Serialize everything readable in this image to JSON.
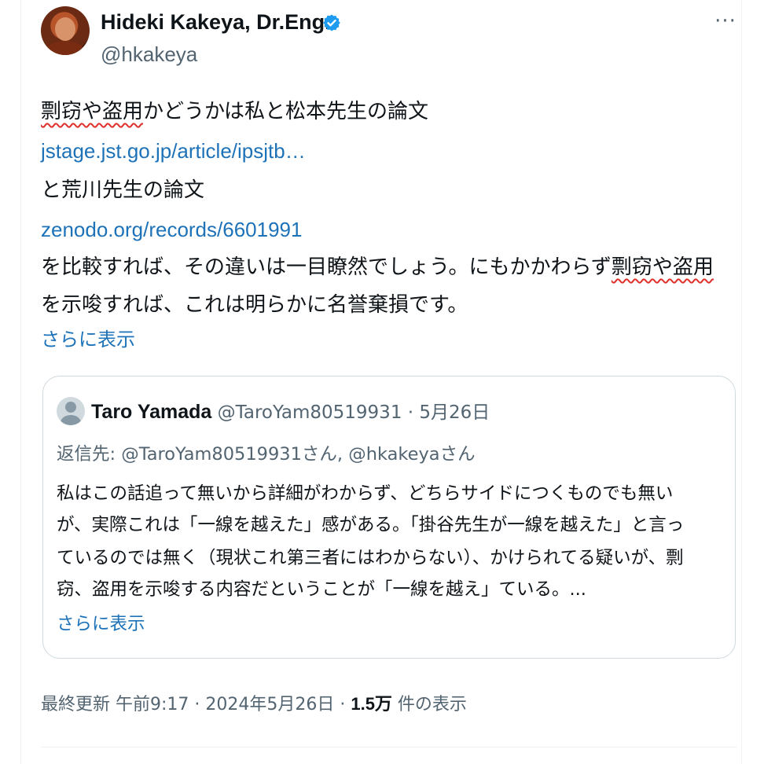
{
  "author": {
    "name": "Hideki Kakeya, Dr.Eng.",
    "handle": "@hkakeya",
    "avatar_icon": "profile-photo",
    "verified_icon": "verified-badge-icon",
    "verified_color": "#1d9bf0"
  },
  "more_label": "···",
  "tweet": {
    "line1_a": "剽窃や盗用",
    "line1_b": "かどうかは私と松本先生の論文",
    "link1": "jstage.jst.go.jp/article/ipsjtb…",
    "line3": "と荒川先生の論文",
    "link2": "zenodo.org/records/6601991",
    "line5_a": "を比較すれば、その違いは一目瞭然でしょう。にもかかわらず",
    "line5_b": "剽窃や盗用",
    "line6": "を示唆すれば、これは明らかに名誉棄損です。",
    "show_more": "さらに表示"
  },
  "quoted": {
    "name": "Taro Yamada",
    "handle": "@TaroYam80519931",
    "separator": "·",
    "date": "5月26日",
    "reply_to": "返信先: @TaroYam80519931さん, @hkakeyaさん",
    "lines": [
      "私はこの話追って無いから詳細がわからず、どちらサイドにつくものでも無い",
      "が、実際これは「一線を越えた」感がある。「掛谷先生が一線を越えた」と言っ",
      "ているのでは無く（現状これ第三者にはわからない）、かけられてる疑いが、剽",
      "窃、盗用を示唆する内容だということが「一線を越え」ている。..."
    ],
    "show_more": "さらに表示"
  },
  "meta": {
    "updated": "最終更新 午前9:17 · 2024年5月26日 · ",
    "views_count": "1.5万",
    "views_label": " 件の表示"
  },
  "colors": {
    "link": "#1d72b8",
    "squiggle": "#e0302b",
    "border": "#cfd9de",
    "secondary_text": "#536471"
  }
}
